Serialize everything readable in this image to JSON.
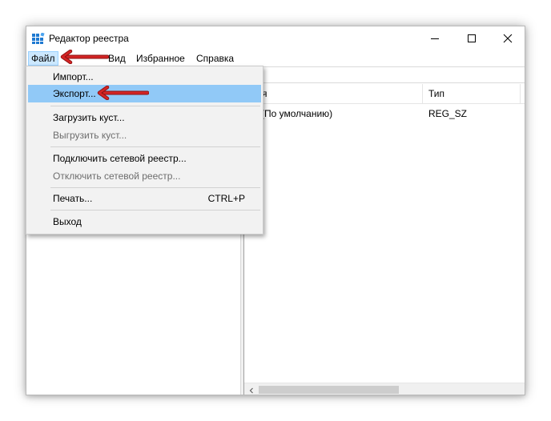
{
  "window": {
    "title": "Редактор реестра",
    "icon": "registry-editor-icon",
    "controls": {
      "minimize_icon": "minimize-icon",
      "maximize_icon": "maximize-icon",
      "close_icon": "close-icon"
    }
  },
  "menubar": {
    "items": [
      {
        "label": "Файл",
        "active": true
      },
      {
        "label": "Вид"
      },
      {
        "label": "Избранное"
      },
      {
        "label": "Справка"
      }
    ]
  },
  "file_menu": {
    "items": [
      {
        "label": "Импорт...",
        "enabled": true
      },
      {
        "label": "Экспорт...",
        "enabled": true,
        "highlighted": true
      },
      {
        "label": "Загрузить куст...",
        "enabled": true
      },
      {
        "label": "Выгрузить куст...",
        "enabled": false
      },
      {
        "label": "Подключить сетевой реестр...",
        "enabled": true
      },
      {
        "label": "Отключить сетевой реестр...",
        "enabled": false
      },
      {
        "label": "Печать...",
        "enabled": true,
        "shortcut": "CTRL+P"
      },
      {
        "label": "Выход",
        "enabled": true
      }
    ]
  },
  "values_pane": {
    "columns": [
      "Имя",
      "Тип"
    ],
    "visible_name_header_fragment": "я",
    "rows": [
      {
        "name": "(По умолчанию)",
        "type": "REG_SZ"
      }
    ],
    "scroll_left_icon": "scroll-left-arrow-icon"
  },
  "annotations": {
    "arrow_color": "#cc1f1f",
    "arrow_icon": "red-pointer-arrow-icon"
  },
  "colors": {
    "menu_highlight": "#91c9f7",
    "menubar_active": "#cce8ff",
    "icon_blue": "#1f7ad1"
  }
}
